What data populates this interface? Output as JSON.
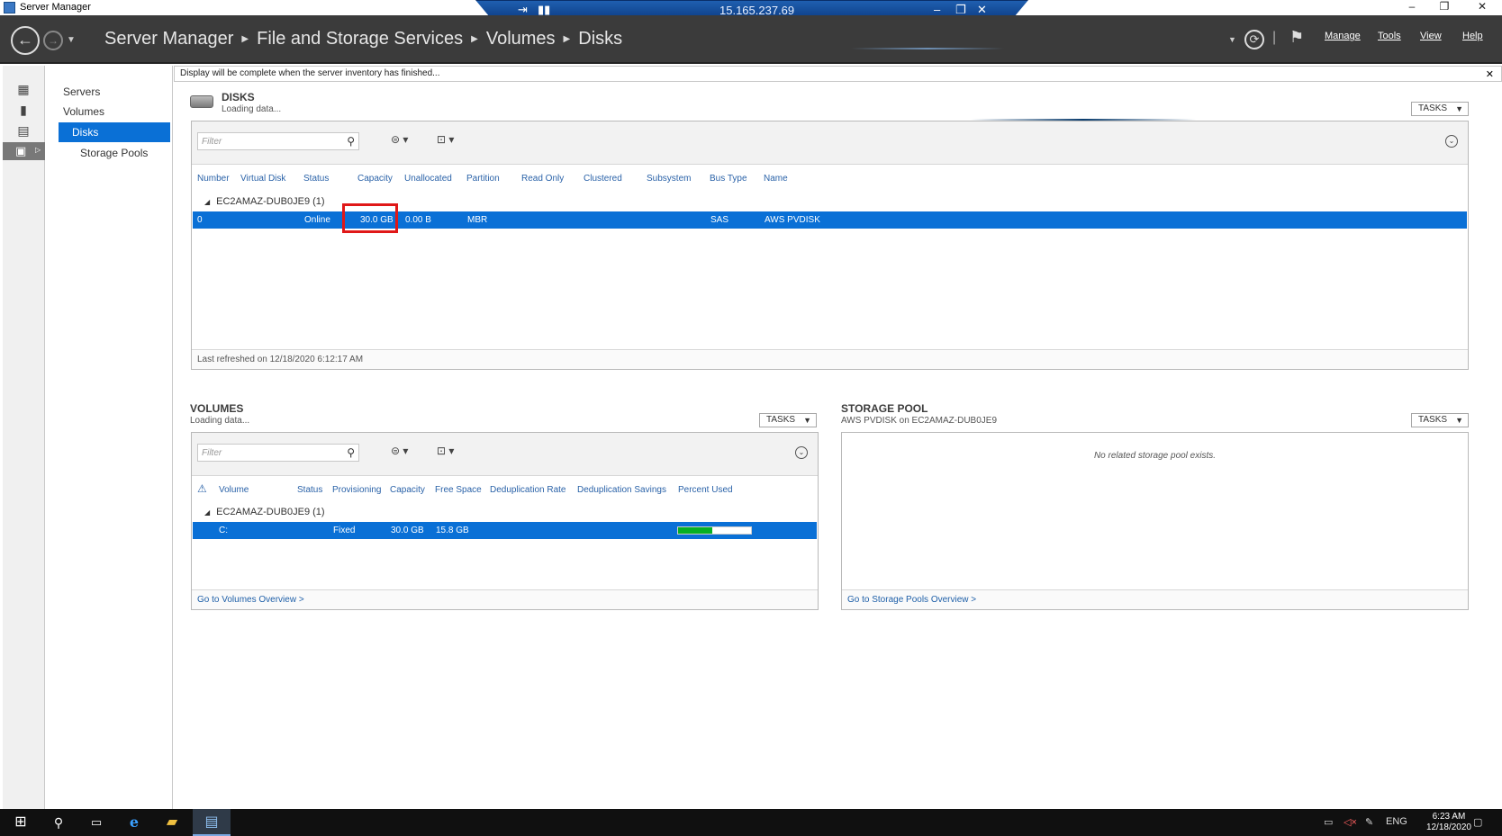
{
  "window": {
    "title": "Server Manager",
    "minimize": "–",
    "restore": "❐",
    "close": "✕"
  },
  "remote_bar": {
    "ip": "15.165.237.69",
    "pin_icon": "pin-icon",
    "signal_icon": "signal-icon",
    "minimize": "–",
    "restore": "❐",
    "close": "✕"
  },
  "header": {
    "breadcrumb": [
      "Server Manager",
      "File and Storage Services",
      "Volumes",
      "Disks"
    ],
    "menu": [
      "Manage",
      "Tools",
      "View",
      "Help"
    ]
  },
  "rail": {
    "icons": [
      "dashboard-icon",
      "local-server-icon",
      "all-servers-icon",
      "file-storage-icon"
    ]
  },
  "nav": {
    "items": [
      "Servers",
      "Volumes",
      "Disks",
      "Storage Pools"
    ],
    "selected": "Disks"
  },
  "notice": {
    "text": "Display will be complete when the server inventory has finished...",
    "close": "✕"
  },
  "disks": {
    "title": "DISKS",
    "subtitle": "Loading data...",
    "tasks": "TASKS",
    "filter_placeholder": "Filter",
    "columns": [
      "Number",
      "Virtual Disk",
      "Status",
      "Capacity",
      "Unallocated",
      "Partition",
      "Read Only",
      "Clustered",
      "Subsystem",
      "Bus Type",
      "Name"
    ],
    "group": "EC2AMAZ-DUB0JE9 (1)",
    "row": {
      "number": "0",
      "status": "Online",
      "capacity": "30.0 GB",
      "unallocated": "0.00 B",
      "partition": "MBR",
      "bus_type": "SAS",
      "name": "AWS PVDISK"
    },
    "footer": "Last refreshed on 12/18/2020 6:12:17 AM"
  },
  "volumes": {
    "title": "VOLUMES",
    "subtitle": "Loading data...",
    "tasks": "TASKS",
    "filter_placeholder": "Filter",
    "columns": [
      "Volume",
      "Status",
      "Provisioning",
      "Capacity",
      "Free Space",
      "Deduplication Rate",
      "Deduplication Savings",
      "Percent Used"
    ],
    "group": "EC2AMAZ-DUB0JE9 (1)",
    "row": {
      "volume": "C:",
      "provisioning": "Fixed",
      "capacity": "30.0 GB",
      "free_space": "15.8 GB",
      "percent_used_fraction": 0.47
    },
    "link": "Go to Volumes Overview >"
  },
  "storage_pool": {
    "title": "STORAGE POOL",
    "subtitle": "AWS PVDISK on EC2AMAZ-DUB0JE9",
    "tasks": "TASKS",
    "empty": "No related storage pool exists.",
    "link": "Go to Storage Pools Overview >"
  },
  "taskbar": {
    "apps": [
      "start-icon",
      "search-icon",
      "task-view-icon",
      "internet-explorer-icon",
      "file-explorer-icon",
      "server-manager-icon"
    ],
    "lang": "ENG",
    "time": "6:23 AM",
    "date": "12/18/2020"
  },
  "colors": {
    "accent": "#0a70d6",
    "highlight": "#e01818",
    "usage": "#06b025"
  }
}
